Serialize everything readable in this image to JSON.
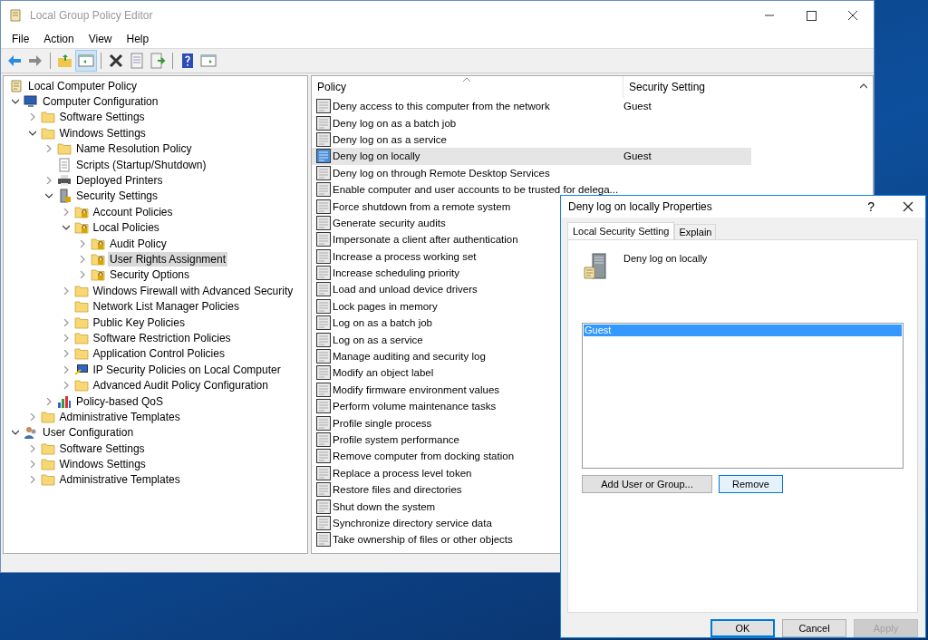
{
  "window": {
    "title": "Local Group Policy Editor"
  },
  "menu": [
    "File",
    "Action",
    "View",
    "Help"
  ],
  "toolbar": [
    [
      {
        "kind": "back",
        "pressed": false
      },
      {
        "kind": "forward",
        "pressed": false
      }
    ],
    [
      {
        "kind": "up",
        "pressed": false
      },
      {
        "kind": "tree",
        "pressed": true
      }
    ],
    [
      {
        "kind": "delete",
        "pressed": false
      },
      {
        "kind": "properties",
        "pressed": false
      },
      {
        "kind": "export",
        "pressed": false
      }
    ],
    [
      {
        "kind": "help",
        "pressed": false
      },
      {
        "kind": "pane",
        "pressed": false
      }
    ]
  ],
  "tree": [
    {
      "label": "Local Computer Policy",
      "kind": "scroll",
      "selected": false,
      "children": [
        {
          "label": "Computer Configuration",
          "kind": "computer",
          "expanded": true,
          "selected": false,
          "children": [
            {
              "label": "Software Settings",
              "kind": "folder",
              "expanded": false,
              "selected": false
            },
            {
              "label": "Windows Settings",
              "kind": "folder",
              "expanded": true,
              "selected": false,
              "children": [
                {
                  "label": "Name Resolution Policy",
                  "kind": "folder",
                  "expanded": false,
                  "selected": false
                },
                {
                  "label": "Scripts (Startup/Shutdown)",
                  "kind": "script",
                  "selected": false
                },
                {
                  "label": "Deployed Printers",
                  "kind": "printer",
                  "expanded": false,
                  "selected": false
                },
                {
                  "label": "Security Settings",
                  "kind": "security",
                  "expanded": true,
                  "selected": false,
                  "children": [
                    {
                      "label": "Account Policies",
                      "kind": "lockfolder",
                      "expanded": false,
                      "selected": false
                    },
                    {
                      "label": "Local Policies",
                      "kind": "lockfolder",
                      "expanded": true,
                      "selected": false,
                      "children": [
                        {
                          "label": "Audit Policy",
                          "kind": "lockfolder",
                          "expanded": false,
                          "selected": false
                        },
                        {
                          "label": "User Rights Assignment",
                          "kind": "lockfolder",
                          "expanded": false,
                          "selected": true
                        },
                        {
                          "label": "Security Options",
                          "kind": "lockfolder",
                          "expanded": false,
                          "selected": false
                        }
                      ]
                    },
                    {
                      "label": "Windows Firewall with Advanced Security",
                      "kind": "folder",
                      "expanded": false,
                      "selected": false
                    },
                    {
                      "label": "Network List Manager Policies",
                      "kind": "folder",
                      "selected": false
                    },
                    {
                      "label": "Public Key Policies",
                      "kind": "folder",
                      "expanded": false,
                      "selected": false
                    },
                    {
                      "label": "Software Restriction Policies",
                      "kind": "folder",
                      "expanded": false,
                      "selected": false
                    },
                    {
                      "label": "Application Control Policies",
                      "kind": "folder",
                      "expanded": false,
                      "selected": false
                    },
                    {
                      "label": "IP Security Policies on Local Computer",
                      "kind": "ip",
                      "expanded": false,
                      "selected": false
                    },
                    {
                      "label": "Advanced Audit Policy Configuration",
                      "kind": "folder",
                      "expanded": false,
                      "selected": false
                    }
                  ]
                },
                {
                  "label": "Policy-based QoS",
                  "kind": "qos",
                  "expanded": false,
                  "selected": false
                }
              ]
            },
            {
              "label": "Administrative Templates",
              "kind": "folder",
              "expanded": false,
              "selected": false
            }
          ]
        },
        {
          "label": "User Configuration",
          "kind": "user",
          "expanded": true,
          "selected": false,
          "children": [
            {
              "label": "Software Settings",
              "kind": "folder",
              "expanded": false,
              "selected": false
            },
            {
              "label": "Windows Settings",
              "kind": "folder",
              "expanded": false,
              "selected": false
            },
            {
              "label": "Administrative Templates",
              "kind": "folder",
              "expanded": false,
              "selected": false
            }
          ]
        }
      ]
    }
  ],
  "policies": {
    "columns": [
      "Policy",
      "Security Setting"
    ],
    "rows": [
      {
        "policy": "Deny access to this computer from the network",
        "setting": "Guest",
        "selected": false
      },
      {
        "policy": "Deny log on as a batch job",
        "selected": false
      },
      {
        "policy": "Deny log on as a service",
        "selected": false
      },
      {
        "policy": "Deny log on locally",
        "setting": "Guest",
        "selected": true
      },
      {
        "policy": "Deny log on through Remote Desktop Services",
        "selected": false
      },
      {
        "policy": "Enable computer and user accounts to be trusted for delega...",
        "selected": false
      },
      {
        "policy": "Force shutdown from a remote system",
        "selected": false
      },
      {
        "policy": "Generate security audits",
        "selected": false
      },
      {
        "policy": "Impersonate a client after authentication",
        "selected": false
      },
      {
        "policy": "Increase a process working set",
        "selected": false
      },
      {
        "policy": "Increase scheduling priority",
        "selected": false
      },
      {
        "policy": "Load and unload device drivers",
        "selected": false
      },
      {
        "policy": "Lock pages in memory",
        "selected": false
      },
      {
        "policy": "Log on as a batch job",
        "selected": false
      },
      {
        "policy": "Log on as a service",
        "selected": false
      },
      {
        "policy": "Manage auditing and security log",
        "selected": false
      },
      {
        "policy": "Modify an object label",
        "selected": false
      },
      {
        "policy": "Modify firmware environment values",
        "selected": false
      },
      {
        "policy": "Perform volume maintenance tasks",
        "selected": false
      },
      {
        "policy": "Profile single process",
        "selected": false
      },
      {
        "policy": "Profile system performance",
        "selected": false
      },
      {
        "policy": "Remove computer from docking station",
        "selected": false
      },
      {
        "policy": "Replace a process level token",
        "selected": false
      },
      {
        "policy": "Restore files and directories",
        "selected": false
      },
      {
        "policy": "Shut down the system",
        "selected": false
      },
      {
        "policy": "Synchronize directory service data",
        "selected": false
      },
      {
        "policy": "Take ownership of files or other objects",
        "selected": false
      }
    ]
  },
  "dialog": {
    "title": "Deny log on locally Properties",
    "help": "?",
    "tabs": [
      {
        "label": "Local Security Setting",
        "selected": true
      },
      {
        "label": "Explain",
        "selected": false
      }
    ],
    "policy_name": "Deny log on locally",
    "members": [
      {
        "name": "Guest",
        "selected": true
      }
    ],
    "list_buttons": [
      {
        "label": "Add User or Group...",
        "focused": false
      },
      {
        "label": "Remove",
        "focused": true
      }
    ],
    "buttons": [
      {
        "label": "OK",
        "default": true,
        "disabled": false
      },
      {
        "label": "Cancel",
        "default": false,
        "disabled": false
      },
      {
        "label": "Apply",
        "default": false,
        "disabled": true
      }
    ]
  }
}
